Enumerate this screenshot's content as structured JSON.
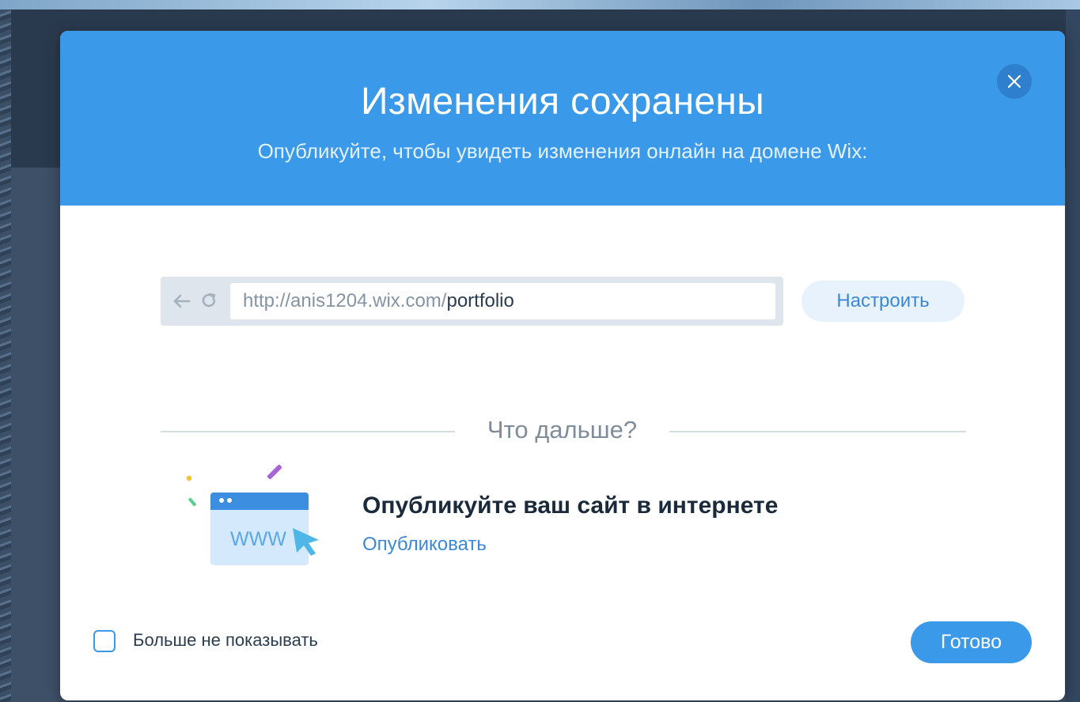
{
  "dialog": {
    "title": "Изменения сохранены",
    "subtitle": "Опубликуйте, чтобы увидеть изменения онлайн на домене Wix:",
    "close_icon": "close-icon"
  },
  "url_bar": {
    "back_icon": "arrow-left-icon",
    "reload_icon": "reload-icon",
    "url_base": "http://anis1204.wix.com/",
    "url_path": "portfolio",
    "configure_label": "Настроить"
  },
  "next_section": {
    "divider_label": "Что дальше?",
    "illustration_text": "WWW",
    "title": "Опубликуйте ваш сайт в интернете",
    "link_label": "Опубликовать"
  },
  "footer": {
    "checkbox_label": "Больше не показывать",
    "checkbox_checked": false,
    "done_label": "Готово"
  },
  "colors": {
    "header_blue": "#3b99ea",
    "link_blue": "#3b88d6",
    "button_light": "#e7f2fd"
  }
}
